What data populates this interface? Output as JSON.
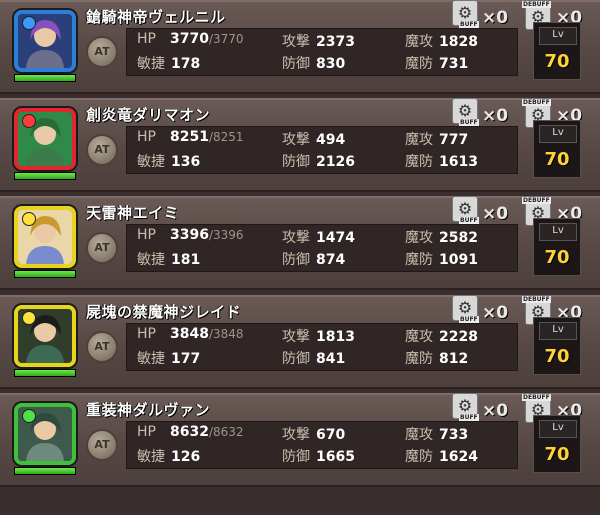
{
  "labels": {
    "hp": "HP",
    "attack": "攻撃",
    "magic_attack": "魔攻",
    "agility": "敏捷",
    "defense": "防御",
    "magic_defense": "魔防",
    "at_button": "AT",
    "buff": "BUFF",
    "debuff": "DEBUFF",
    "lv": "Lv"
  },
  "party": [
    {
      "name": "鎗騎神帝ヴェルニル",
      "hp": "3770",
      "hp_max": "/3770",
      "atk": "2373",
      "matk": "1828",
      "agi": "178",
      "def": "830",
      "mdef": "731",
      "buff_count": "×0",
      "debuff_count": "×0",
      "level": "70",
      "frame_color": "#2b7fd6",
      "orb_color": "#3a9bff",
      "hp_ratio": 1.0
    },
    {
      "name": "創炎竜ダリマオン",
      "hp": "8251",
      "hp_max": "/8251",
      "atk": "494",
      "matk": "777",
      "agi": "136",
      "def": "2126",
      "mdef": "1613",
      "buff_count": "×0",
      "debuff_count": "×0",
      "level": "70",
      "frame_color": "#e0262e",
      "orb_color": "#ff3b3b",
      "hp_ratio": 1.0
    },
    {
      "name": "天雷神エイミ",
      "hp": "3396",
      "hp_max": "/3396",
      "atk": "1474",
      "matk": "2582",
      "agi": "181",
      "def": "874",
      "mdef": "1091",
      "buff_count": "×0",
      "debuff_count": "×0",
      "level": "70",
      "frame_color": "#e8d41c",
      "orb_color": "#ffe23a",
      "hp_ratio": 1.0
    },
    {
      "name": "屍塊の禁魔神ジレイド",
      "hp": "3848",
      "hp_max": "/3848",
      "atk": "1813",
      "matk": "2228",
      "agi": "177",
      "def": "841",
      "mdef": "812",
      "buff_count": "×0",
      "debuff_count": "×0",
      "level": "70",
      "frame_color": "#e8d41c",
      "orb_color": "#ffe23a",
      "hp_ratio": 1.0
    },
    {
      "name": "重装神ダルヴァン",
      "hp": "8632",
      "hp_max": "/8632",
      "atk": "670",
      "matk": "733",
      "agi": "126",
      "def": "1665",
      "mdef": "1624",
      "buff_count": "×0",
      "debuff_count": "×0",
      "level": "70",
      "frame_color": "#3fbf3a",
      "orb_color": "#4fe04a",
      "hp_ratio": 1.0
    }
  ]
}
